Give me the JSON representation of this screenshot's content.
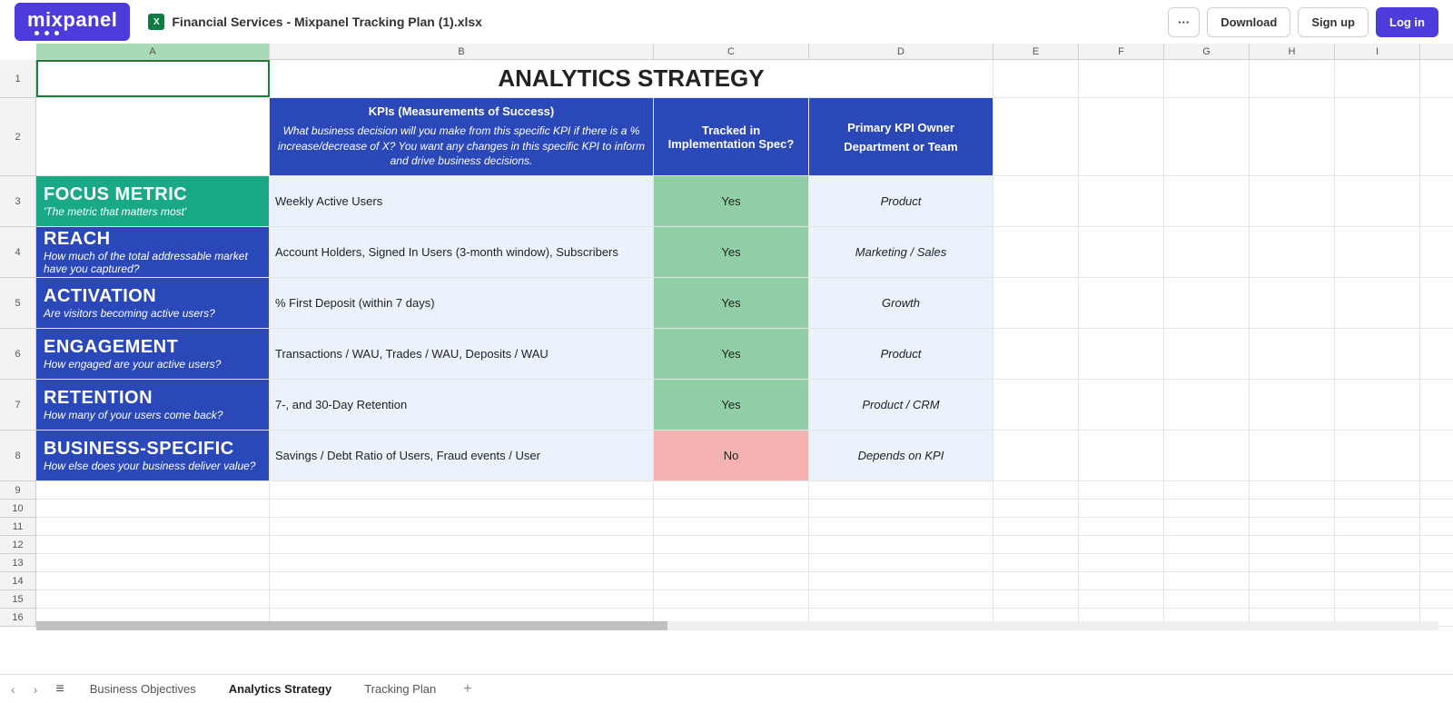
{
  "header": {
    "logo_text": "mixpanel",
    "filename": "Financial Services - Mixpanel Tracking Plan (1).xlsx",
    "buttons": {
      "more": "···",
      "download": "Download",
      "signup": "Sign up",
      "login": "Log in"
    }
  },
  "columns": [
    "A",
    "B",
    "C",
    "D",
    "E",
    "F",
    "G",
    "H",
    "I"
  ],
  "row_numbers": [
    "1",
    "2",
    "3",
    "4",
    "5",
    "6",
    "7",
    "8",
    "9",
    "10",
    "11",
    "12",
    "13",
    "14",
    "15",
    "16"
  ],
  "cells": {
    "title": "ANALYTICS STRATEGY",
    "col_b_header_title": "KPIs (Measurements of Success)",
    "col_b_header_sub": "What business decision will you make from this specific KPI if there is a % increase/decrease of X? You want any changes in this specific KPI to inform and drive business decisions.",
    "col_c_header": "Tracked in Implementation Spec?",
    "col_d_header_line1": "Primary KPI Owner",
    "col_d_header_line2": "Department or Team",
    "rows": [
      {
        "name": "FOCUS METRIC",
        "sub": "'The metric that matters most'",
        "b": "Weekly Active Users",
        "c": "Yes",
        "d": "Product",
        "cClass": "data-green"
      },
      {
        "name": "REACH",
        "sub": "How much of the total addressable market have you captured?",
        "b": "Account Holders, Signed In Users (3-month window), Subscribers",
        "c": "Yes",
        "d": "Marketing / Sales",
        "cClass": "data-green"
      },
      {
        "name": "ACTIVATION",
        "sub": "Are visitors becoming active users?",
        "b": "% First Deposit (within 7 days)",
        "c": "Yes",
        "d": "Growth",
        "cClass": "data-green"
      },
      {
        "name": "ENGAGEMENT",
        "sub": "How engaged are your active users?",
        "b": "Transactions / WAU, Trades / WAU, Deposits / WAU",
        "c": "Yes",
        "d": "Product",
        "cClass": "data-green"
      },
      {
        "name": "RETENTION",
        "sub": "How many of your users come back?",
        "b": "7-, and 30-Day Retention",
        "c": "Yes",
        "d": "Product / CRM",
        "cClass": "data-green"
      },
      {
        "name": "BUSINESS-SPECIFIC",
        "sub": "How else does your business deliver value?",
        "b": "Savings / Debt Ratio of Users, Fraud events / User",
        "c": "No",
        "d": "Depends on KPI",
        "cClass": "data-red"
      }
    ]
  },
  "sheets": [
    "Business Objectives",
    "Analytics Strategy",
    "Tracking Plan"
  ],
  "active_sheet": 1
}
